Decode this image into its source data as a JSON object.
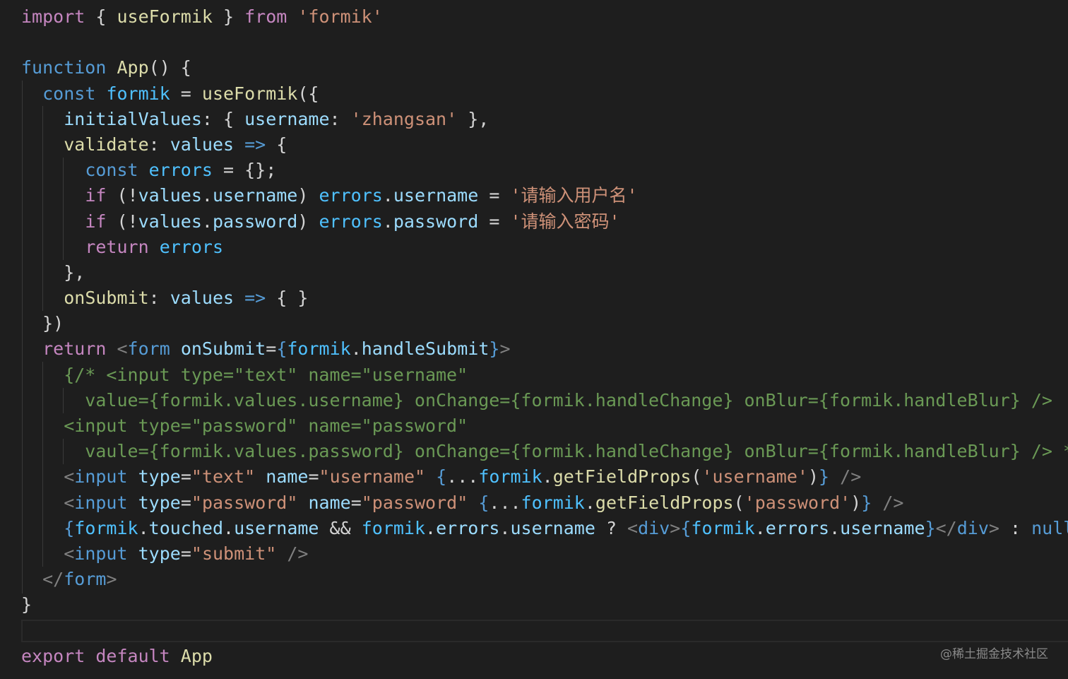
{
  "editor": {
    "lines": [
      [
        {
          "t": "import",
          "c": "kw"
        },
        {
          "t": " { ",
          "c": "pun"
        },
        {
          "t": "useFormik",
          "c": "fn"
        },
        {
          "t": " } ",
          "c": "pun"
        },
        {
          "t": "from",
          "c": "kw"
        },
        {
          "t": " ",
          "c": "pun"
        },
        {
          "t": "'formik'",
          "c": "str"
        }
      ],
      [],
      [
        {
          "t": "function",
          "c": "st"
        },
        {
          "t": " ",
          "c": "pun"
        },
        {
          "t": "App",
          "c": "fn"
        },
        {
          "t": "() {",
          "c": "pun"
        }
      ],
      [
        {
          "t": "  ",
          "c": "pun"
        },
        {
          "t": "const",
          "c": "st"
        },
        {
          "t": " ",
          "c": "pun"
        },
        {
          "t": "formik",
          "c": "cst"
        },
        {
          "t": " = ",
          "c": "pun"
        },
        {
          "t": "useFormik",
          "c": "fn"
        },
        {
          "t": "({",
          "c": "pun"
        }
      ],
      [
        {
          "t": "    ",
          "c": "pun"
        },
        {
          "t": "initialValues",
          "c": "var"
        },
        {
          "t": ": { ",
          "c": "pun"
        },
        {
          "t": "username",
          "c": "var"
        },
        {
          "t": ": ",
          "c": "pun"
        },
        {
          "t": "'zhangsan'",
          "c": "str"
        },
        {
          "t": " },",
          "c": "pun"
        }
      ],
      [
        {
          "t": "    ",
          "c": "pun"
        },
        {
          "t": "validate",
          "c": "fn"
        },
        {
          "t": ": ",
          "c": "pun"
        },
        {
          "t": "values",
          "c": "var"
        },
        {
          "t": " ",
          "c": "pun"
        },
        {
          "t": "=>",
          "c": "st"
        },
        {
          "t": " {",
          "c": "pun"
        }
      ],
      [
        {
          "t": "      ",
          "c": "pun"
        },
        {
          "t": "const",
          "c": "st"
        },
        {
          "t": " ",
          "c": "pun"
        },
        {
          "t": "errors",
          "c": "cst"
        },
        {
          "t": " = {};",
          "c": "pun"
        }
      ],
      [
        {
          "t": "      ",
          "c": "pun"
        },
        {
          "t": "if",
          "c": "kw"
        },
        {
          "t": " (!",
          "c": "pun"
        },
        {
          "t": "values",
          "c": "var"
        },
        {
          "t": ".",
          "c": "pun"
        },
        {
          "t": "username",
          "c": "var"
        },
        {
          "t": ") ",
          "c": "pun"
        },
        {
          "t": "errors",
          "c": "cst"
        },
        {
          "t": ".",
          "c": "pun"
        },
        {
          "t": "username",
          "c": "var"
        },
        {
          "t": " = ",
          "c": "pun"
        },
        {
          "t": "'请输入用户名'",
          "c": "str"
        }
      ],
      [
        {
          "t": "      ",
          "c": "pun"
        },
        {
          "t": "if",
          "c": "kw"
        },
        {
          "t": " (!",
          "c": "pun"
        },
        {
          "t": "values",
          "c": "var"
        },
        {
          "t": ".",
          "c": "pun"
        },
        {
          "t": "password",
          "c": "var"
        },
        {
          "t": ") ",
          "c": "pun"
        },
        {
          "t": "errors",
          "c": "cst"
        },
        {
          "t": ".",
          "c": "pun"
        },
        {
          "t": "password",
          "c": "var"
        },
        {
          "t": " = ",
          "c": "pun"
        },
        {
          "t": "'请输入密码'",
          "c": "str"
        }
      ],
      [
        {
          "t": "      ",
          "c": "pun"
        },
        {
          "t": "return",
          "c": "kw"
        },
        {
          "t": " ",
          "c": "pun"
        },
        {
          "t": "errors",
          "c": "cst"
        }
      ],
      [
        {
          "t": "    },",
          "c": "pun"
        }
      ],
      [
        {
          "t": "    ",
          "c": "pun"
        },
        {
          "t": "onSubmit",
          "c": "fn"
        },
        {
          "t": ": ",
          "c": "pun"
        },
        {
          "t": "values",
          "c": "var"
        },
        {
          "t": " ",
          "c": "pun"
        },
        {
          "t": "=>",
          "c": "st"
        },
        {
          "t": " { }",
          "c": "pun"
        }
      ],
      [
        {
          "t": "  })",
          "c": "pun"
        }
      ],
      [
        {
          "t": "  ",
          "c": "pun"
        },
        {
          "t": "return",
          "c": "kw"
        },
        {
          "t": " ",
          "c": "pun"
        },
        {
          "t": "<",
          "c": "tag"
        },
        {
          "t": "form",
          "c": "st"
        },
        {
          "t": " ",
          "c": "pun"
        },
        {
          "t": "onSubmit",
          "c": "var"
        },
        {
          "t": "=",
          "c": "pun"
        },
        {
          "t": "{",
          "c": "st"
        },
        {
          "t": "formik",
          "c": "cst"
        },
        {
          "t": ".",
          "c": "pun"
        },
        {
          "t": "handleSubmit",
          "c": "var"
        },
        {
          "t": "}",
          "c": "st"
        },
        {
          "t": ">",
          "c": "tag"
        }
      ],
      [
        {
          "t": "    {/* <input type=\"text\" name=\"username\"",
          "c": "cm"
        }
      ],
      [
        {
          "t": "      value={formik.values.username} onChange={formik.handleChange} onBlur={formik.handleBlur} />",
          "c": "cm"
        }
      ],
      [
        {
          "t": "    <input type=\"password\" name=\"password\"",
          "c": "cm"
        }
      ],
      [
        {
          "t": "      vaule={formik.values.password} onChange={formik.handleChange} onBlur={formik.handleBlur} /> */}",
          "c": "cm"
        }
      ],
      [
        {
          "t": "    ",
          "c": "pun"
        },
        {
          "t": "<",
          "c": "tag"
        },
        {
          "t": "input",
          "c": "st"
        },
        {
          "t": " ",
          "c": "pun"
        },
        {
          "t": "type",
          "c": "var"
        },
        {
          "t": "=",
          "c": "pun"
        },
        {
          "t": "\"text\"",
          "c": "str"
        },
        {
          "t": " ",
          "c": "pun"
        },
        {
          "t": "name",
          "c": "var"
        },
        {
          "t": "=",
          "c": "pun"
        },
        {
          "t": "\"username\"",
          "c": "str"
        },
        {
          "t": " ",
          "c": "pun"
        },
        {
          "t": "{",
          "c": "st"
        },
        {
          "t": "...",
          "c": "pun"
        },
        {
          "t": "formik",
          "c": "cst"
        },
        {
          "t": ".",
          "c": "pun"
        },
        {
          "t": "getFieldProps",
          "c": "fn"
        },
        {
          "t": "(",
          "c": "pun"
        },
        {
          "t": "'username'",
          "c": "str"
        },
        {
          "t": ")",
          "c": "pun"
        },
        {
          "t": "}",
          "c": "st"
        },
        {
          "t": " ",
          "c": "pun"
        },
        {
          "t": "/>",
          "c": "tag"
        }
      ],
      [
        {
          "t": "    ",
          "c": "pun"
        },
        {
          "t": "<",
          "c": "tag"
        },
        {
          "t": "input",
          "c": "st"
        },
        {
          "t": " ",
          "c": "pun"
        },
        {
          "t": "type",
          "c": "var"
        },
        {
          "t": "=",
          "c": "pun"
        },
        {
          "t": "\"password\"",
          "c": "str"
        },
        {
          "t": " ",
          "c": "pun"
        },
        {
          "t": "name",
          "c": "var"
        },
        {
          "t": "=",
          "c": "pun"
        },
        {
          "t": "\"password\"",
          "c": "str"
        },
        {
          "t": " ",
          "c": "pun"
        },
        {
          "t": "{",
          "c": "st"
        },
        {
          "t": "...",
          "c": "pun"
        },
        {
          "t": "formik",
          "c": "cst"
        },
        {
          "t": ".",
          "c": "pun"
        },
        {
          "t": "getFieldProps",
          "c": "fn"
        },
        {
          "t": "(",
          "c": "pun"
        },
        {
          "t": "'password'",
          "c": "str"
        },
        {
          "t": ")",
          "c": "pun"
        },
        {
          "t": "}",
          "c": "st"
        },
        {
          "t": " ",
          "c": "pun"
        },
        {
          "t": "/>",
          "c": "tag"
        }
      ],
      [
        {
          "t": "    ",
          "c": "pun"
        },
        {
          "t": "{",
          "c": "st"
        },
        {
          "t": "formik",
          "c": "cst"
        },
        {
          "t": ".",
          "c": "pun"
        },
        {
          "t": "touched",
          "c": "var"
        },
        {
          "t": ".",
          "c": "pun"
        },
        {
          "t": "username",
          "c": "var"
        },
        {
          "t": " && ",
          "c": "pun"
        },
        {
          "t": "formik",
          "c": "cst"
        },
        {
          "t": ".",
          "c": "pun"
        },
        {
          "t": "errors",
          "c": "var"
        },
        {
          "t": ".",
          "c": "pun"
        },
        {
          "t": "username",
          "c": "var"
        },
        {
          "t": " ? ",
          "c": "pun"
        },
        {
          "t": "<",
          "c": "tag"
        },
        {
          "t": "div",
          "c": "st"
        },
        {
          "t": ">",
          "c": "tag"
        },
        {
          "t": "{",
          "c": "st"
        },
        {
          "t": "formik",
          "c": "cst"
        },
        {
          "t": ".",
          "c": "pun"
        },
        {
          "t": "errors",
          "c": "var"
        },
        {
          "t": ".",
          "c": "pun"
        },
        {
          "t": "username",
          "c": "var"
        },
        {
          "t": "}",
          "c": "st"
        },
        {
          "t": "</",
          "c": "tag"
        },
        {
          "t": "div",
          "c": "st"
        },
        {
          "t": ">",
          "c": "tag"
        },
        {
          "t": " : ",
          "c": "pun"
        },
        {
          "t": "null",
          "c": "st"
        },
        {
          "t": "}",
          "c": "st"
        }
      ],
      [
        {
          "t": "    ",
          "c": "pun"
        },
        {
          "t": "<",
          "c": "tag"
        },
        {
          "t": "input",
          "c": "st"
        },
        {
          "t": " ",
          "c": "pun"
        },
        {
          "t": "type",
          "c": "var"
        },
        {
          "t": "=",
          "c": "pun"
        },
        {
          "t": "\"submit\"",
          "c": "str"
        },
        {
          "t": " ",
          "c": "pun"
        },
        {
          "t": "/>",
          "c": "tag"
        }
      ],
      [
        {
          "t": "  ",
          "c": "pun"
        },
        {
          "t": "</",
          "c": "tag"
        },
        {
          "t": "form",
          "c": "st"
        },
        {
          "t": ">",
          "c": "tag"
        }
      ],
      [
        {
          "t": "}",
          "c": "pun"
        }
      ],
      [],
      [
        {
          "t": "export",
          "c": "kw"
        },
        {
          "t": " ",
          "c": "pun"
        },
        {
          "t": "default",
          "c": "kw"
        },
        {
          "t": " ",
          "c": "pun"
        },
        {
          "t": "App",
          "c": "fn"
        }
      ]
    ]
  },
  "watermark": "@稀土掘金技术社区"
}
